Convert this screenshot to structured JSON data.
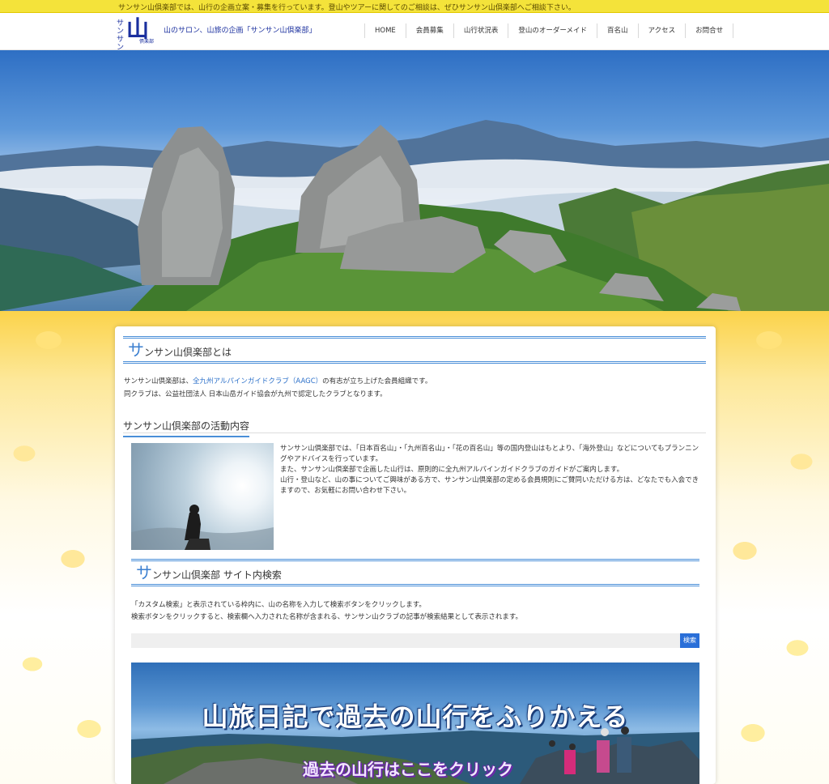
{
  "topbar": {
    "text": "サンサン山倶楽部では、山行の企画立案・募集を行っています。登山やツアーに関してのご相談は、ぜひサンサン山倶楽部へご相談下さい。"
  },
  "header": {
    "logo_sub": "サンサン",
    "logo_main": "山",
    "logo_club": "倶楽部",
    "tagline": "山のサロン、山旅の企画「サンサン山倶楽部」"
  },
  "nav": {
    "items": [
      "HOME",
      "会員募集",
      "山行状況表",
      "登山のオーダーメイド",
      "百名山",
      "アクセス",
      "お問合せ"
    ]
  },
  "hero": {
    "slides_total": 3,
    "active_slide": 1
  },
  "about": {
    "title_first": "サ",
    "title_rest": "ンサン山倶楽部とは",
    "line1_pre": "サンサン山倶楽部は、",
    "line1_link": "全九州アルパインガイドクラブ（AAGC）",
    "line1_post": "の有志が立ち上げた会員組織です。",
    "line2": "同クラブは、公益社団法人 日本山岳ガイド協会が九州で認定したクラブとなります。"
  },
  "activity": {
    "heading": "サンサン山倶楽部の活動内容",
    "text": "サンサン山倶楽部では、「日本百名山」・「九州百名山」・「花の百名山」等の国内登山はもとより、「海外登山」などについてもプランニングやアドバイスを行っています。",
    "text2": "また、サンサン山倶楽部で企画した山行は、原則的に全九州アルパインガイドクラブのガイドがご案内します。",
    "text3": "山行・登山など、山の事についてご興味がある方で、サンサン山倶楽部の定める会員規則にご賛同いただける方は、どなたでも入会できますので、お気軽にお問い合わせ下さい。"
  },
  "search": {
    "title_first": "サ",
    "title_rest": "ンサン山倶楽部 サイト内検索",
    "line1": "「カスタム検索」と表示されている枠内に、山の名称を入力して検索ボタンをクリックします。",
    "line2": "検索ボタンをクリックすると、検索欄へ入力された名称が含まれる、サンサン山クラブの記事が検索結果として表示されます。",
    "placeholder": "",
    "button": "検索"
  },
  "banner": {
    "title": "山旅日記で過去の山行をふりかえる",
    "subtitle": "過去の山行はここをクリック"
  }
}
